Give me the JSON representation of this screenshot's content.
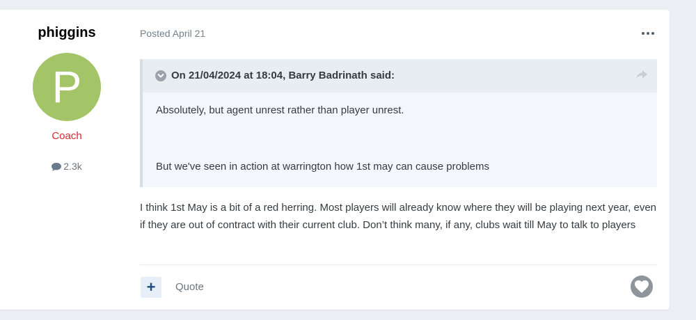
{
  "author": {
    "name": "phiggins",
    "avatar_letter": "P",
    "avatar_color": "#a3c567",
    "group": "Coach",
    "group_color": "#e0262f",
    "post_count": "2.3k"
  },
  "post": {
    "posted_label": "Posted April 21",
    "quote": {
      "citation": "On 21/04/2024 at 18:04, Barry Badrinath said:",
      "lines": [
        "Absolutely,  but agent unrest rather than player unrest.",
        "But we've seen in action at warrington how 1st may can cause problems"
      ]
    },
    "body": "I think 1st May is a bit of a red herring. Most players will already know where they will be playing next year, even if they are out of contract with their current club. Don’t think many, if any, clubs wait till May to talk to players"
  },
  "actions": {
    "add_symbol": "+",
    "quote_label": "Quote"
  },
  "icons": {
    "more": "ellipsis-icon",
    "toggle": "chevron-down-icon",
    "share": "share-icon",
    "comment": "comment-bubble-icon",
    "reaction": "heart-icon"
  }
}
